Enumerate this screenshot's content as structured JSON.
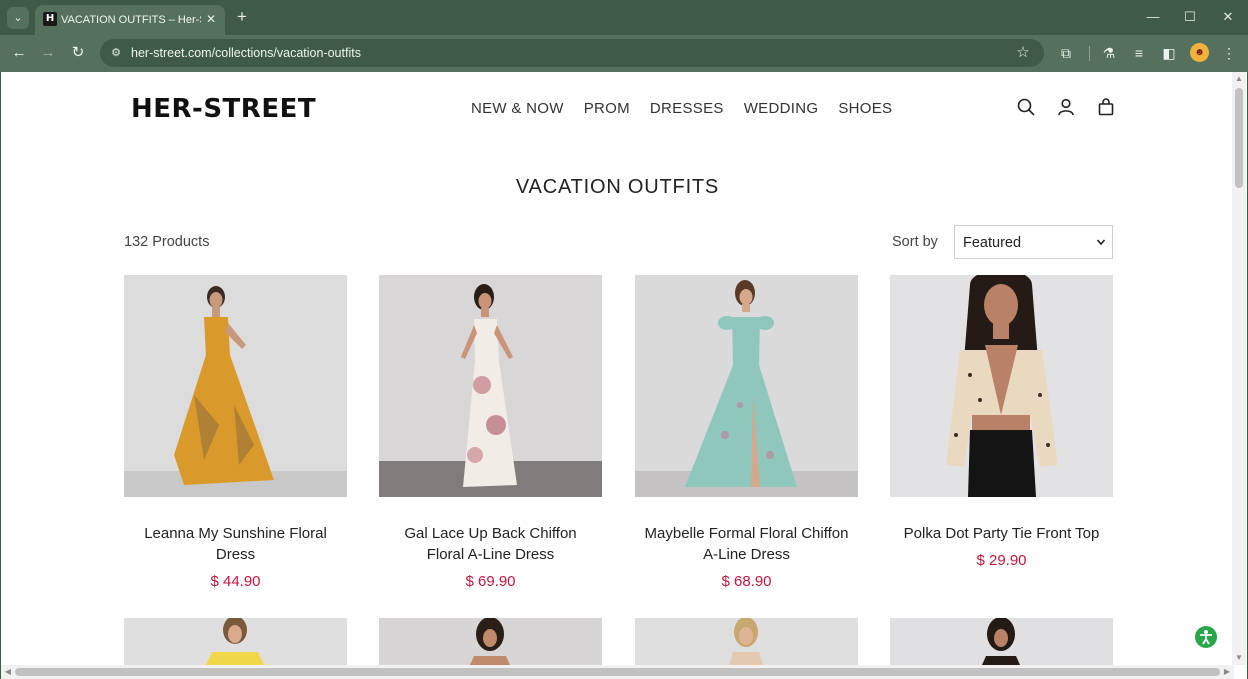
{
  "browser": {
    "tab_title": "VACATION OUTFITS – Her-Street",
    "url": "her-street.com/collections/vacation-outfits",
    "profile_initial": "☻"
  },
  "site": {
    "logo": "HER-STREET",
    "nav": [
      "NEW & NOW",
      "PROM",
      "DRESSES",
      "WEDDING",
      "SHOES"
    ]
  },
  "page": {
    "title": "VACATION OUTFITS",
    "product_count": "132 Products",
    "sort_label": "Sort by",
    "sort_value": "Featured"
  },
  "products": [
    {
      "name": "Leanna My Sunshine Floral Dress",
      "price": "$ 44.90",
      "dress_color": "#d99a2b",
      "bg": "#dcdcdc"
    },
    {
      "name": "Gal Lace Up Back Chiffon Floral A-Line Dress",
      "price": "$ 69.90",
      "dress_color": "#f2ece6",
      "bg": "#d8d6d7"
    },
    {
      "name": "Maybelle Formal Floral Chiffon A-Line Dress",
      "price": "$ 68.90",
      "dress_color": "#8fc7bd",
      "bg": "#dadada"
    },
    {
      "name": "Polka Dot Party Tie Front Top",
      "price": "$ 29.90",
      "dress_color": "#e8d9c0",
      "bg": "#e2e2e4"
    }
  ],
  "colors": {
    "price": "#c5163a",
    "chrome": "#55705d",
    "chrome_dark": "#3f5b48"
  }
}
